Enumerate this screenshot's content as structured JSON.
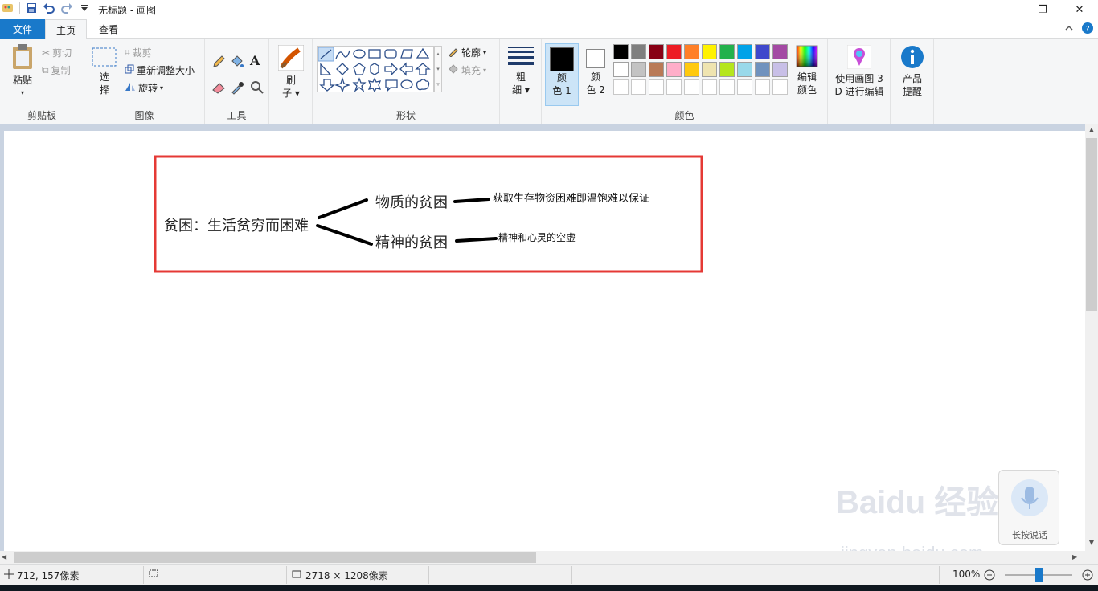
{
  "window": {
    "title": "无标题 - 画图",
    "minimize_label": "–",
    "maximize_label": "❐",
    "close_label": "✕"
  },
  "tabs": {
    "file": "文件",
    "home": "主页",
    "view": "查看"
  },
  "ribbon": {
    "clipboard": {
      "paste": "粘贴",
      "cut": "剪切",
      "copy": "复制",
      "group_label": "剪贴板"
    },
    "image": {
      "select_line1": "选",
      "select_line2": "择",
      "crop": "裁剪",
      "resize": "重新调整大小",
      "rotate": "旋转",
      "group_label": "图像"
    },
    "tools": {
      "group_label": "工具"
    },
    "brushes": {
      "line1": "刷",
      "line2": "子"
    },
    "shapes": {
      "outline": "轮廓",
      "fill": "填充",
      "group_label": "形状"
    },
    "size": {
      "line1": "粗",
      "line2": "细"
    },
    "colors": {
      "color1_line1": "颜",
      "color1_line2": "色 1",
      "color2_line1": "颜",
      "color2_line2": "色 2",
      "edit_line1": "编辑",
      "edit_line2": "颜色",
      "group_label": "颜色",
      "color1": "#000000",
      "color2": "#ffffff",
      "palette": [
        "#000000",
        "#7f7f7f",
        "#880015",
        "#ed1c24",
        "#ff7f27",
        "#fff200",
        "#22b14c",
        "#00a2e8",
        "#3f48cc",
        "#a349a4",
        "#ffffff",
        "#c3c3c3",
        "#b97a57",
        "#ffaec9",
        "#ffc90e",
        "#efe4b0",
        "#b5e61d",
        "#99d9ea",
        "#7092be",
        "#c8bfe7",
        "#ffffff",
        "#ffffff",
        "#ffffff",
        "#ffffff",
        "#ffffff",
        "#ffffff",
        "#ffffff",
        "#ffffff",
        "#ffffff",
        "#ffffff"
      ]
    },
    "paint3d": {
      "line1": "使用画图 3",
      "line2": "D 进行编辑"
    },
    "product": {
      "line1": "产品",
      "line2": "提醒"
    }
  },
  "canvas": {
    "border_color": "#e53935",
    "root_text": "贫困：生活贫穷而困难",
    "branch1": "物质的贫困",
    "branch2": "精神的贫困",
    "leaf1": "获取生存物资困难即温饱难以保证",
    "leaf2": "精神和心灵的空虚"
  },
  "status": {
    "cursor_pos": "712, 157像素",
    "image_size": "2718 × 1208像素",
    "zoom": "100%"
  },
  "voice_panel": {
    "label": "长按说话"
  },
  "watermark": {
    "line1": "Baidu 经验",
    "line2": "jingyan.baidu.com"
  }
}
